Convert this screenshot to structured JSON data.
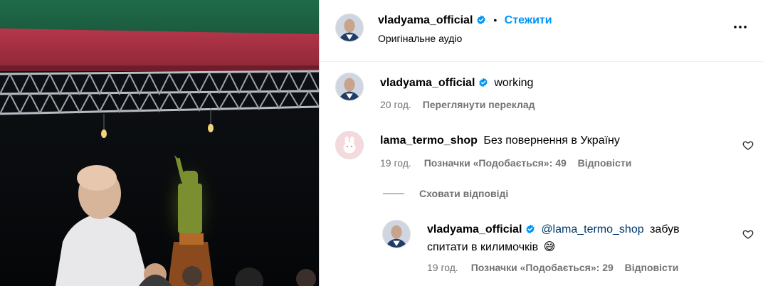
{
  "post": {
    "author": "vladyama_official",
    "follow_label": "Стежити",
    "separator": "•",
    "audio_label": "Оригінальне аудіо"
  },
  "caption": {
    "author": "vladyama_official",
    "text": "working",
    "time": "20 год.",
    "translate_label": "Переглянути переклад"
  },
  "comments": [
    {
      "author": "lama_termo_shop",
      "text": "Без повернення в Україну",
      "time": "19 год.",
      "likes_label": "Позначки «Подобається»: 49",
      "reply_label": "Відповісти",
      "hide_replies_label": "Сховати відповіді",
      "replies": [
        {
          "author": "vladyama_official",
          "mention": "@lama_termo_shop",
          "text_line1": "забув",
          "text_line2": "спитати в килимочків",
          "emoji": "😅",
          "time": "19 год.",
          "likes_label": "Позначки «Подобається»: 29",
          "reply_label": "Відповісти"
        }
      ]
    }
  ],
  "icons": {
    "verified": "verified-badge-icon",
    "more": "more-options-icon",
    "heart": "heart-outline-icon"
  },
  "colors": {
    "link_blue": "#0095f6",
    "mention": "#00376b",
    "verified": "#0095f6",
    "secondary_text": "#737373"
  }
}
